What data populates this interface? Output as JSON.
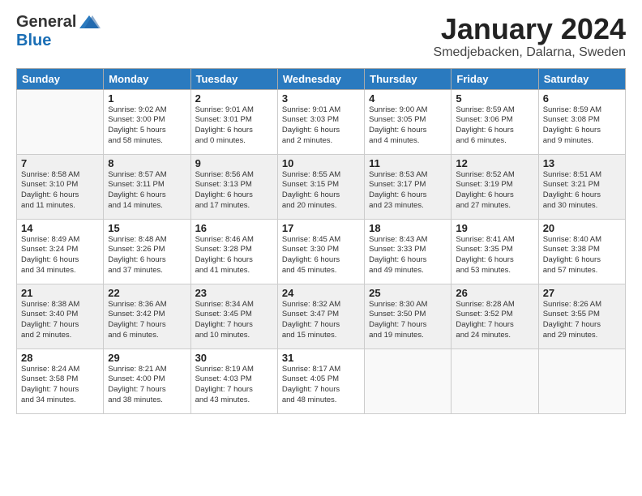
{
  "header": {
    "logo_general": "General",
    "logo_blue": "Blue",
    "month_title": "January 2024",
    "location": "Smedjebacken, Dalarna, Sweden"
  },
  "days_of_week": [
    "Sunday",
    "Monday",
    "Tuesday",
    "Wednesday",
    "Thursday",
    "Friday",
    "Saturday"
  ],
  "weeks": [
    [
      {
        "day": null,
        "info": null
      },
      {
        "day": "1",
        "info": "Sunrise: 9:02 AM\nSunset: 3:00 PM\nDaylight: 5 hours\nand 58 minutes."
      },
      {
        "day": "2",
        "info": "Sunrise: 9:01 AM\nSunset: 3:01 PM\nDaylight: 6 hours\nand 0 minutes."
      },
      {
        "day": "3",
        "info": "Sunrise: 9:01 AM\nSunset: 3:03 PM\nDaylight: 6 hours\nand 2 minutes."
      },
      {
        "day": "4",
        "info": "Sunrise: 9:00 AM\nSunset: 3:05 PM\nDaylight: 6 hours\nand 4 minutes."
      },
      {
        "day": "5",
        "info": "Sunrise: 8:59 AM\nSunset: 3:06 PM\nDaylight: 6 hours\nand 6 minutes."
      },
      {
        "day": "6",
        "info": "Sunrise: 8:59 AM\nSunset: 3:08 PM\nDaylight: 6 hours\nand 9 minutes."
      }
    ],
    [
      {
        "day": "7",
        "info": "Sunrise: 8:58 AM\nSunset: 3:10 PM\nDaylight: 6 hours\nand 11 minutes."
      },
      {
        "day": "8",
        "info": "Sunrise: 8:57 AM\nSunset: 3:11 PM\nDaylight: 6 hours\nand 14 minutes."
      },
      {
        "day": "9",
        "info": "Sunrise: 8:56 AM\nSunset: 3:13 PM\nDaylight: 6 hours\nand 17 minutes."
      },
      {
        "day": "10",
        "info": "Sunrise: 8:55 AM\nSunset: 3:15 PM\nDaylight: 6 hours\nand 20 minutes."
      },
      {
        "day": "11",
        "info": "Sunrise: 8:53 AM\nSunset: 3:17 PM\nDaylight: 6 hours\nand 23 minutes."
      },
      {
        "day": "12",
        "info": "Sunrise: 8:52 AM\nSunset: 3:19 PM\nDaylight: 6 hours\nand 27 minutes."
      },
      {
        "day": "13",
        "info": "Sunrise: 8:51 AM\nSunset: 3:21 PM\nDaylight: 6 hours\nand 30 minutes."
      }
    ],
    [
      {
        "day": "14",
        "info": "Sunrise: 8:49 AM\nSunset: 3:24 PM\nDaylight: 6 hours\nand 34 minutes."
      },
      {
        "day": "15",
        "info": "Sunrise: 8:48 AM\nSunset: 3:26 PM\nDaylight: 6 hours\nand 37 minutes."
      },
      {
        "day": "16",
        "info": "Sunrise: 8:46 AM\nSunset: 3:28 PM\nDaylight: 6 hours\nand 41 minutes."
      },
      {
        "day": "17",
        "info": "Sunrise: 8:45 AM\nSunset: 3:30 PM\nDaylight: 6 hours\nand 45 minutes."
      },
      {
        "day": "18",
        "info": "Sunrise: 8:43 AM\nSunset: 3:33 PM\nDaylight: 6 hours\nand 49 minutes."
      },
      {
        "day": "19",
        "info": "Sunrise: 8:41 AM\nSunset: 3:35 PM\nDaylight: 6 hours\nand 53 minutes."
      },
      {
        "day": "20",
        "info": "Sunrise: 8:40 AM\nSunset: 3:38 PM\nDaylight: 6 hours\nand 57 minutes."
      }
    ],
    [
      {
        "day": "21",
        "info": "Sunrise: 8:38 AM\nSunset: 3:40 PM\nDaylight: 7 hours\nand 2 minutes."
      },
      {
        "day": "22",
        "info": "Sunrise: 8:36 AM\nSunset: 3:42 PM\nDaylight: 7 hours\nand 6 minutes."
      },
      {
        "day": "23",
        "info": "Sunrise: 8:34 AM\nSunset: 3:45 PM\nDaylight: 7 hours\nand 10 minutes."
      },
      {
        "day": "24",
        "info": "Sunrise: 8:32 AM\nSunset: 3:47 PM\nDaylight: 7 hours\nand 15 minutes."
      },
      {
        "day": "25",
        "info": "Sunrise: 8:30 AM\nSunset: 3:50 PM\nDaylight: 7 hours\nand 19 minutes."
      },
      {
        "day": "26",
        "info": "Sunrise: 8:28 AM\nSunset: 3:52 PM\nDaylight: 7 hours\nand 24 minutes."
      },
      {
        "day": "27",
        "info": "Sunrise: 8:26 AM\nSunset: 3:55 PM\nDaylight: 7 hours\nand 29 minutes."
      }
    ],
    [
      {
        "day": "28",
        "info": "Sunrise: 8:24 AM\nSunset: 3:58 PM\nDaylight: 7 hours\nand 34 minutes."
      },
      {
        "day": "29",
        "info": "Sunrise: 8:21 AM\nSunset: 4:00 PM\nDaylight: 7 hours\nand 38 minutes."
      },
      {
        "day": "30",
        "info": "Sunrise: 8:19 AM\nSunset: 4:03 PM\nDaylight: 7 hours\nand 43 minutes."
      },
      {
        "day": "31",
        "info": "Sunrise: 8:17 AM\nSunset: 4:05 PM\nDaylight: 7 hours\nand 48 minutes."
      },
      {
        "day": null,
        "info": null
      },
      {
        "day": null,
        "info": null
      },
      {
        "day": null,
        "info": null
      }
    ]
  ]
}
